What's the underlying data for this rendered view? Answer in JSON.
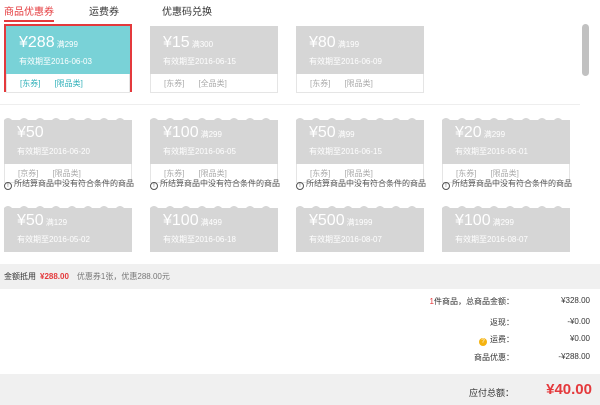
{
  "tabs": [
    {
      "label": "商品优惠券",
      "active": true
    },
    {
      "label": "运费券",
      "active": false
    },
    {
      "label": "优惠码兑换",
      "active": false
    }
  ],
  "coupons_row1": [
    {
      "amount": "¥288",
      "cond": "满299",
      "valid": "有效期至2016-06-03",
      "tags": [
        "[东券]",
        "[限品类]"
      ]
    },
    {
      "amount": "¥15",
      "cond": "满300",
      "valid": "有效期至2016-06-15",
      "tags": [
        "[东券]",
        "[全品类]"
      ]
    },
    {
      "amount": "¥80",
      "cond": "满199",
      "valid": "有效期至2016-06-09",
      "tags": [
        "[东券]",
        "[限品类]"
      ]
    }
  ],
  "coupons_row2": [
    {
      "amount": "¥50",
      "cond": "",
      "valid": "有效期至2016-06-20",
      "tags": [
        "[京券]",
        "[限品类]"
      ],
      "note": "所结算商品中没有符合条件的商品"
    },
    {
      "amount": "¥100",
      "cond": "满299",
      "valid": "有效期至2016-06-05",
      "tags": [
        "[东券]",
        "[限品类]"
      ],
      "note": "所结算商品中没有符合条件的商品"
    },
    {
      "amount": "¥50",
      "cond": "满99",
      "valid": "有效期至2016-06-15",
      "tags": [
        "[东券]",
        "[限品类]"
      ],
      "note": "所结算商品中没有符合条件的商品"
    },
    {
      "amount": "¥20",
      "cond": "满299",
      "valid": "有效期至2016-06-01",
      "tags": [
        "[东券]",
        "[限品类]"
      ],
      "note": "所结算商品中没有符合条件的商品"
    }
  ],
  "coupons_row3": [
    {
      "amount": "¥50",
      "cond": "满129",
      "valid": "有效期至2016-05-02"
    },
    {
      "amount": "¥100",
      "cond": "满499",
      "valid": "有效期至2016-06-18"
    },
    {
      "amount": "¥500",
      "cond": "满1999",
      "valid": "有效期至2016-08-07"
    },
    {
      "amount": "¥100",
      "cond": "满299",
      "valid": "有效期至2016-08-07"
    }
  ],
  "summary": {
    "label": "金额抵用",
    "amount": "¥288.00",
    "detail": "优惠券1张，优惠288.00元"
  },
  "totals": {
    "items_count": "1",
    "items_label": "件商品，总商品金额：",
    "items_value": "¥328.00",
    "rebate_label": "返现：",
    "rebate_value": "-¥0.00",
    "shipping_label": "运费：",
    "shipping_value": "¥0.00",
    "discount_label": "商品优惠：",
    "discount_value": "-¥288.00"
  },
  "payable": {
    "label": "应付总额：",
    "value": "¥40.00"
  },
  "colors": {
    "accent": "#e4393c",
    "active_coupon": "#79d2d7",
    "inactive_coupon": "#d6d6d6"
  }
}
